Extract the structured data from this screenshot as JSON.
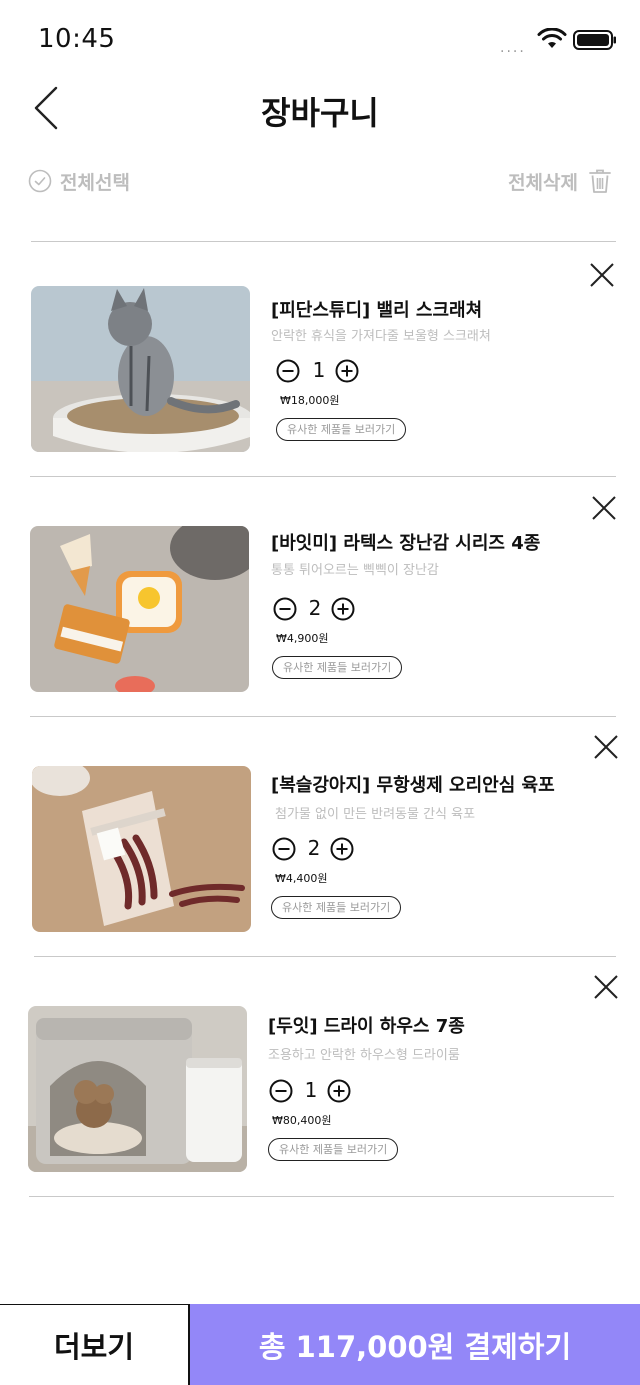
{
  "status_bar": {
    "time": "10:45",
    "signal_dots": "....",
    "wifi_icon": "wifi-icon",
    "battery_icon": "battery-icon"
  },
  "header": {
    "title": "장바구니",
    "back_icon": "chevron-left-icon"
  },
  "toolbar": {
    "select_all_label": "전체선택",
    "delete_all_label": "전체삭제",
    "select_icon": "check-circle-icon",
    "delete_icon": "trash-icon"
  },
  "items": [
    {
      "name": "[피단스튜디] 밸리 스크래쳐",
      "description": "안락한 휴식을 가져다줄 보울형 스크래쳐",
      "quantity": "1",
      "price": "₩18,000원",
      "similar_label": "유사한 제품들 보러가기",
      "image": "cat-on-bowl-scratcher-photo"
    },
    {
      "name": "[바잇미] 라텍스 장난감 시리즈 4종",
      "description": "통통 튀어오르는 삑삑이 장난감",
      "quantity": "2",
      "price": "₩4,900원",
      "similar_label": "유사한 제품들 보러가기",
      "image": "latex-toy-set-photo"
    },
    {
      "name": "[복슬강아지] 무항생제 오리안심 육포",
      "description": "첨가물 없이 만든 반려동물 간식 육포",
      "quantity": "2",
      "price": "₩4,400원",
      "similar_label": "유사한 제품들 보러가기",
      "image": "duck-jerky-bag-photo"
    },
    {
      "name": "[두잇] 드라이 하우스 7종",
      "description": "조용하고 안락한 하우스형 드라이룸",
      "quantity": "1",
      "price": "₩80,400원",
      "similar_label": "유사한 제품들 보러가기",
      "image": "dog-dry-house-photo"
    }
  ],
  "bottom_bar": {
    "more_label": "더보기",
    "checkout_label": "총 117,000원 결제하기"
  },
  "colors": {
    "accent": "#9387f8",
    "muted_text": "#bdbdbd",
    "divider": "#c9c9c9"
  }
}
